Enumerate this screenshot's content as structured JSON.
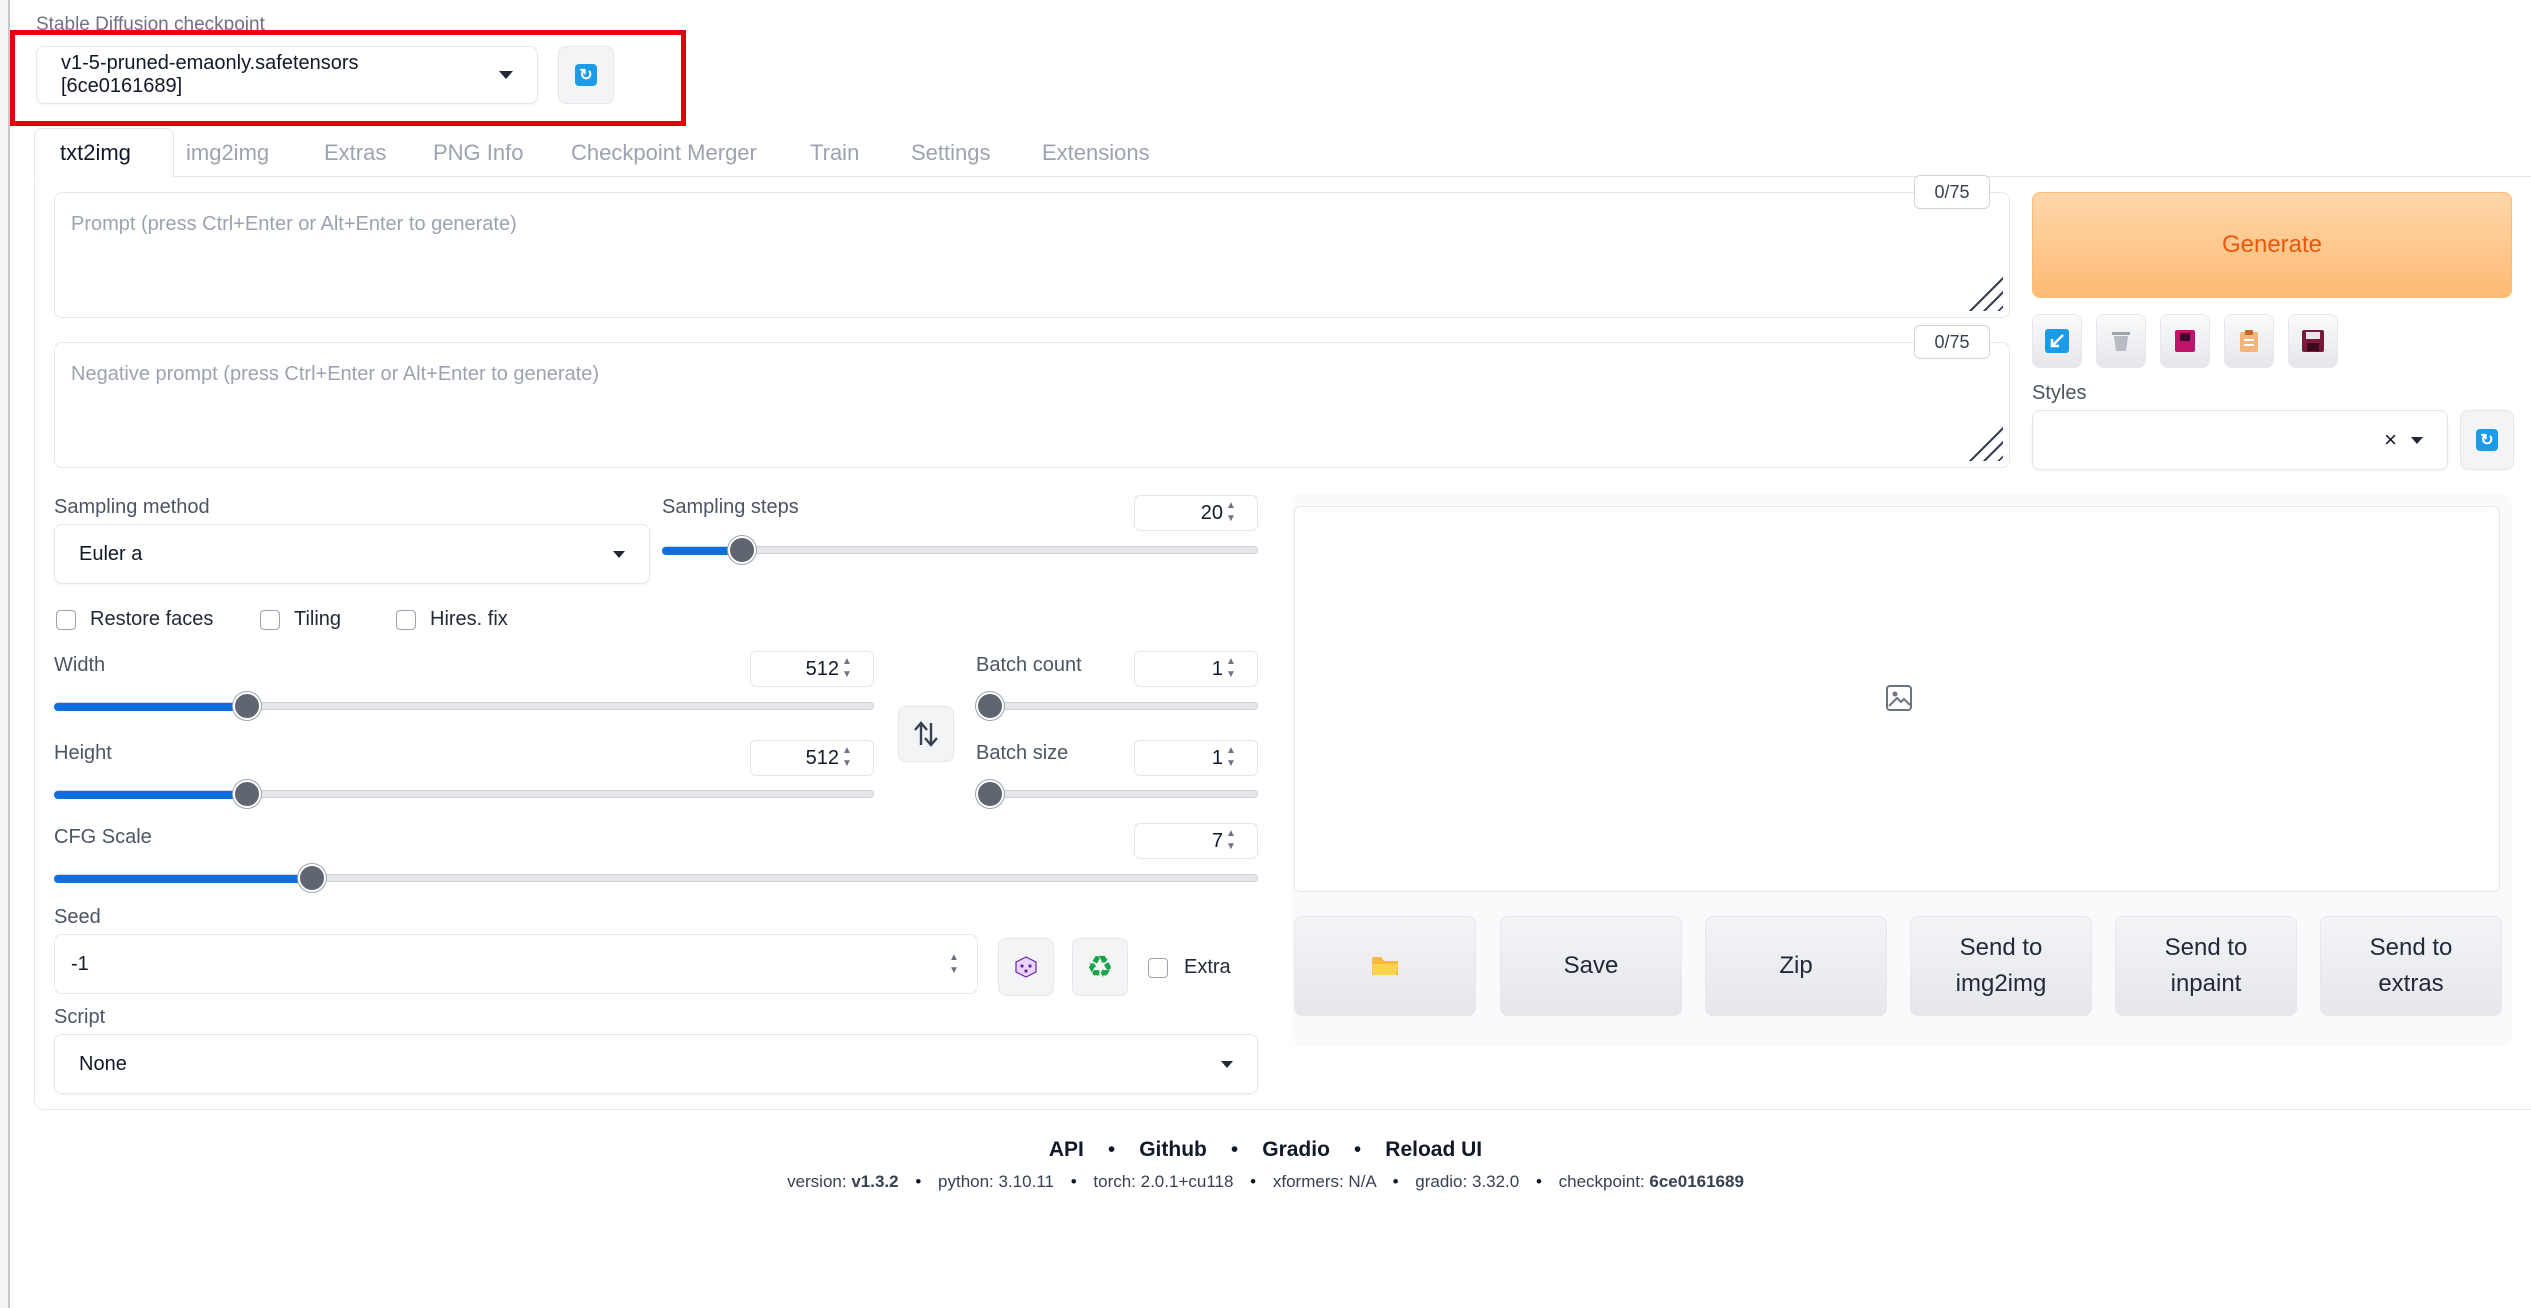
{
  "checkpoint": {
    "label": "Stable Diffusion checkpoint",
    "value": "v1-5-pruned-emaonly.safetensors [6ce0161689]"
  },
  "tabs": [
    {
      "label": "txt2img",
      "active": true
    },
    {
      "label": "img2img"
    },
    {
      "label": "Extras"
    },
    {
      "label": "PNG Info"
    },
    {
      "label": "Checkpoint Merger"
    },
    {
      "label": "Train"
    },
    {
      "label": "Settings"
    },
    {
      "label": "Extensions"
    }
  ],
  "prompt": {
    "placeholder": "Prompt (press Ctrl+Enter or Alt+Enter to generate)",
    "counter": "0/75"
  },
  "negative_prompt": {
    "placeholder": "Negative prompt (press Ctrl+Enter or Alt+Enter to generate)",
    "counter": "0/75"
  },
  "generate_label": "Generate",
  "styles_label": "Styles",
  "styles_clear": "×",
  "sampling_method": {
    "label": "Sampling method",
    "value": "Euler a"
  },
  "sampling_steps": {
    "label": "Sampling steps",
    "value": "20",
    "fraction": 0.135
  },
  "checkboxes": {
    "restore_faces": "Restore faces",
    "tiling": "Tiling",
    "hires_fix": "Hires. fix"
  },
  "width": {
    "label": "Width",
    "value": "512",
    "fraction": 0.235
  },
  "height": {
    "label": "Height",
    "value": "512",
    "fraction": 0.235
  },
  "batch_count": {
    "label": "Batch count",
    "value": "1",
    "fraction": 0.0
  },
  "batch_size": {
    "label": "Batch size",
    "value": "1",
    "fraction": 0.0
  },
  "cfg_scale": {
    "label": "CFG Scale",
    "value": "7",
    "fraction": 0.214
  },
  "seed": {
    "label": "Seed",
    "value": "-1",
    "extra_label": "Extra"
  },
  "script": {
    "label": "Script",
    "value": "None"
  },
  "output_buttons": {
    "save": "Save",
    "zip": "Zip",
    "send_img2img": "Send to img2img",
    "send_inpaint": "Send to inpaint",
    "send_extras": "Send to extras"
  },
  "footer": {
    "links": [
      "API",
      "Github",
      "Gradio",
      "Reload UI"
    ],
    "version_label": "version:",
    "version": "v1.3.2",
    "python": "python: 3.10.11",
    "torch": "torch: 2.0.1+cu118",
    "xformers": "xformers: N/A",
    "gradio": "gradio: 3.32.0",
    "checkpoint_label": "checkpoint:",
    "checkpoint": "6ce0161689"
  },
  "icons": {
    "refresh": "refresh-icon",
    "swap": "swap-vertical-icon",
    "dice": "dice-icon",
    "recycle": "recycle-icon",
    "folder": "folder-icon",
    "image_placeholder": "image-icon"
  },
  "colors": {
    "accent": "#0b6fe0",
    "generate": "#ea580c",
    "highlight_box": "#e3000f"
  }
}
